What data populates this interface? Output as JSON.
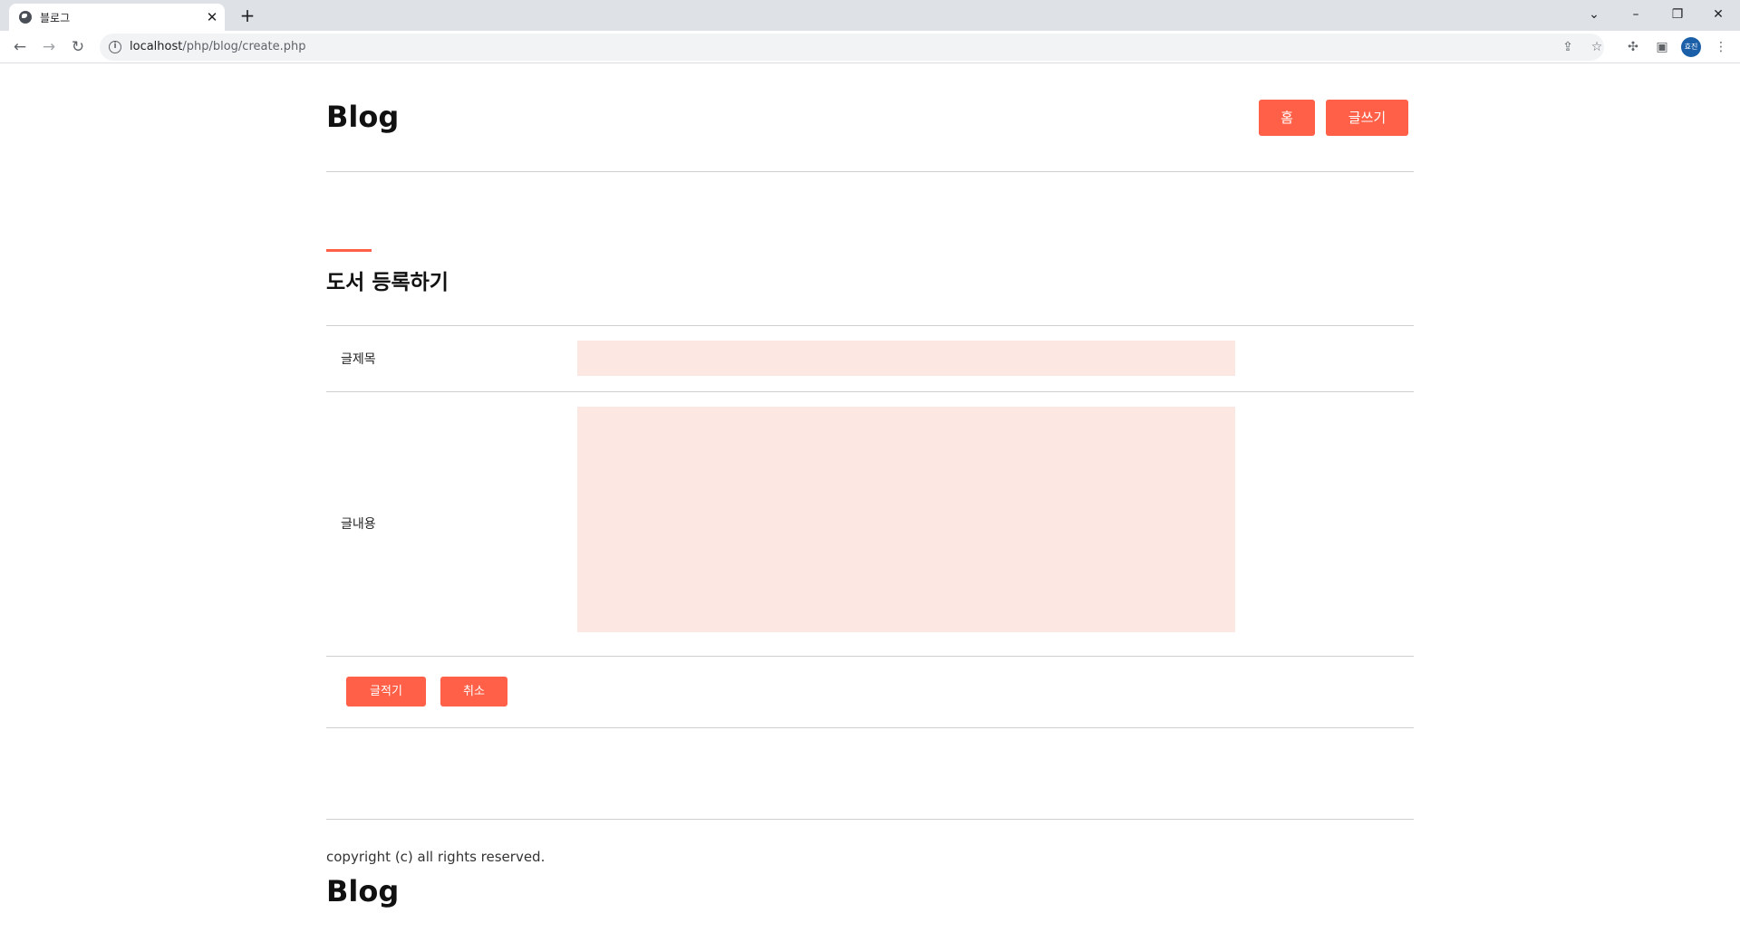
{
  "browser": {
    "tab_title": "블로그",
    "url_host": "localhost",
    "url_path": "/php/blog/create.php",
    "avatar_initials": "효진"
  },
  "header": {
    "logo": "Blog",
    "nav": [
      {
        "label": "홈"
      },
      {
        "label": "글쓰기"
      }
    ]
  },
  "form": {
    "section_title": "도서 등록하기",
    "title_label": "글제목",
    "title_value": "",
    "content_label": "글내용",
    "content_value": "",
    "submit_label": "글적기",
    "cancel_label": "취소"
  },
  "footer": {
    "copyright": "copyright (c) all rights reserved.",
    "logo": "Blog"
  },
  "colors": {
    "accent": "#ff6047",
    "field_bg": "#fce7e2"
  },
  "icons": [
    "globe-icon",
    "close-icon",
    "plus-icon",
    "back-icon",
    "forward-icon",
    "reload-icon",
    "info-icon",
    "share-icon",
    "star-icon",
    "extensions-icon",
    "side-panel-icon",
    "menu-icon"
  ]
}
